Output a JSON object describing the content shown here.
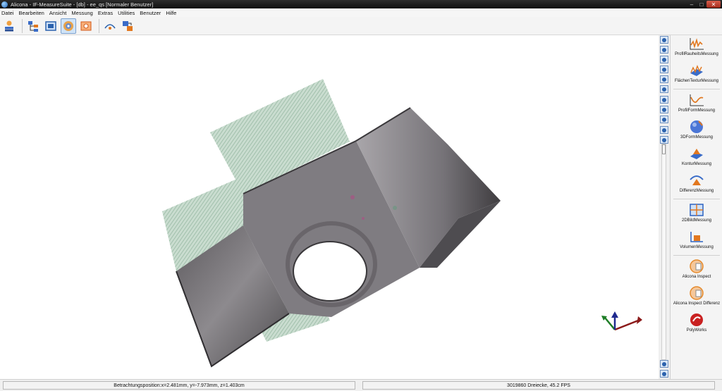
{
  "window": {
    "title": "Alicona - IF-MeasureSuite - [db] - ee_qs [Normaler Benutzer]",
    "controls": {
      "minimize": "–",
      "maximize": "□",
      "close": "✕"
    }
  },
  "menu": {
    "items": [
      "Datei",
      "Bearbeiten",
      "Ansicht",
      "Messung",
      "Extras",
      "Utilities",
      "Benutzer",
      "Hilfe"
    ]
  },
  "toolbar": {
    "buttons": [
      {
        "icon": "user-stack-icon",
        "active": false
      },
      {
        "icon": "tree-hierarchy-icon",
        "active": false
      },
      {
        "icon": "frame-select-icon",
        "active": false
      },
      {
        "icon": "3d-view-icon",
        "active": true
      },
      {
        "icon": "image-view-icon",
        "active": false
      },
      {
        "icon": "measurement-curve-icon",
        "active": false
      },
      {
        "icon": "transfer-icon",
        "active": false
      }
    ]
  },
  "view_tools": {
    "icons": [
      "zoom-in-icon",
      "zoom-out-icon",
      "home-icon",
      "rotate-icon",
      "rotate-axis-icon",
      "box-view-icon",
      "pointer-icon",
      "light-icon",
      "measure-point-icon",
      "save-icon",
      "fit-icon",
      "expand-icon",
      "collapse-icon"
    ]
  },
  "side_panel": {
    "items": [
      {
        "label": "ProfilRauheitsMessung",
        "icon": "profile-roughness-icon",
        "color": "#e2781f"
      },
      {
        "label": "FlächenTexturMessung",
        "icon": "area-texture-icon",
        "color": "#3a6cc8"
      },
      {
        "label": "ProfilFormMessung",
        "icon": "profile-form-icon",
        "color": "#e2781f"
      },
      {
        "label": "3DFormMessung",
        "icon": "3d-form-icon",
        "color": "#4b76d6"
      },
      {
        "label": "KonturMessung",
        "icon": "contour-icon",
        "color": "#e2781f"
      },
      {
        "label": "DifferenzMessung",
        "icon": "difference-icon",
        "color": "#3a6cc8"
      },
      {
        "label": "2DBildMessung",
        "icon": "2d-image-icon",
        "color": "#2d63c1"
      },
      {
        "label": "VolumenMessung",
        "icon": "volume-icon",
        "color": "#e2781f"
      },
      {
        "label": "Alicona Inspect",
        "icon": "inspect-icon",
        "color": "#e58a2c"
      },
      {
        "label": "Alicona Inspect Differenz",
        "icon": "inspect-difference-icon",
        "color": "#e58a2c"
      },
      {
        "label": "PolyWorks",
        "icon": "polyworks-icon",
        "color": "#c92121"
      }
    ]
  },
  "status": {
    "position": "Betrachtungsposition:x=2.481mm, y=-7.973mm, z=1.403cm",
    "render_info": "3019860 Dreiecke, 45.2 FPS"
  },
  "axes_gizmo": {
    "x_color": "#8b1a1a",
    "y_color": "#1e7d26",
    "z_color": "#1f2a8f"
  }
}
